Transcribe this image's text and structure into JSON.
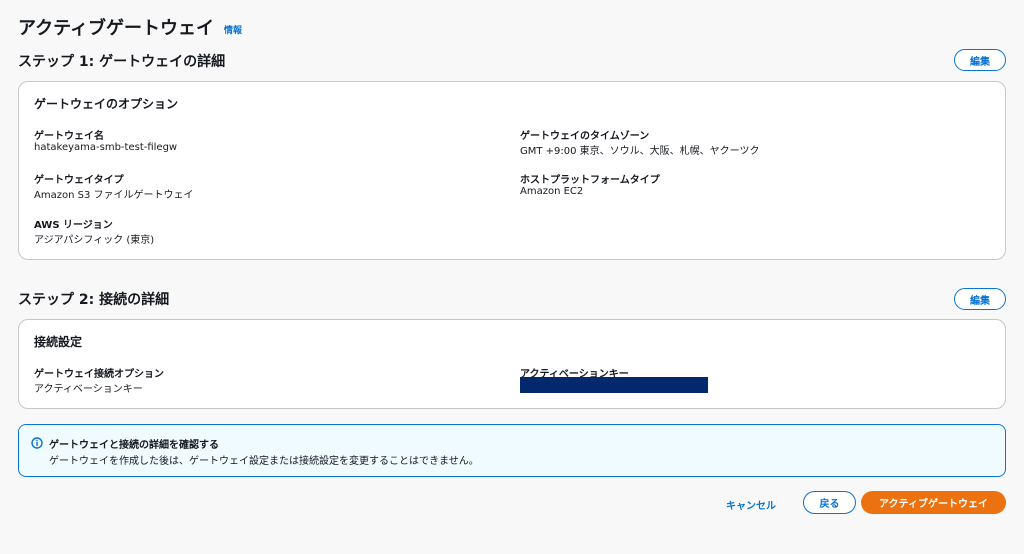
{
  "page": {
    "title": "アクティブゲートウェイ",
    "info_link": "情報"
  },
  "step1": {
    "title": "ステップ 1: ゲートウェイの詳細",
    "edit_label": "編集",
    "card_header": "ゲートウェイのオプション",
    "fields": [
      {
        "label": "ゲートウェイ名",
        "value": "hatakeyama-smb-test-filegw"
      },
      {
        "label": "ゲートウェイのタイムゾーン",
        "value": "GMT +9:00 東京、ソウル、大阪、札幌、ヤクーツク"
      },
      {
        "label": "ゲートウェイタイプ",
        "value": "Amazon S3 ファイルゲートウェイ"
      },
      {
        "label": "ホストプラットフォームタイプ",
        "value": "Amazon EC2"
      },
      {
        "label": "AWS リージョン",
        "value": "アジアパシフィック (東京)"
      }
    ]
  },
  "step2": {
    "title": "ステップ 2: 接続の詳細",
    "edit_label": "編集",
    "card_header": "接続設定",
    "fields": [
      {
        "label": "ゲートウェイ接続オプション",
        "value": "アクティベーションキー"
      },
      {
        "label": "アクティベーションキー",
        "value": ""
      }
    ]
  },
  "alert": {
    "icon": "info-icon",
    "title": "ゲートウェイと接続の詳細を確認する",
    "text": "ゲートウェイを作成した後は、ゲートウェイ設定または接続設定を変更することはできません。"
  },
  "footer": {
    "cancel_label": "キャンセル",
    "back_label": "戻る",
    "primary_label": "アクティブゲートウェイ"
  },
  "colors": {
    "accent": "#0972d3",
    "primary_button": "#ec7211",
    "redaction": "#03286b",
    "alert_background": "#f0fbff"
  }
}
